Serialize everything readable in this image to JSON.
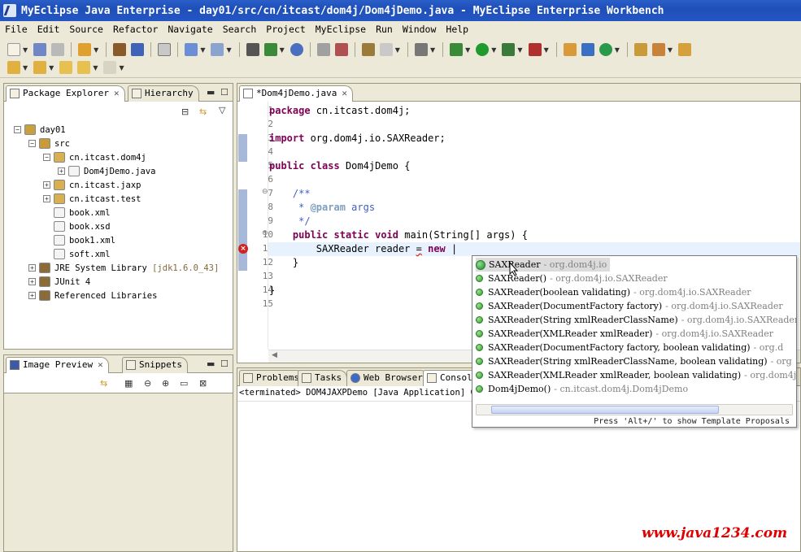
{
  "window": {
    "title": "MyEclipse Java Enterprise - day01/src/cn/itcast/dom4j/Dom4jDemo.java - MyEclipse Enterprise Workbench"
  },
  "menu": [
    "File",
    "Edit",
    "Source",
    "Refactor",
    "Navigate",
    "Search",
    "Project",
    "MyEclipse",
    "Run",
    "Window",
    "Help"
  ],
  "package_explorer": {
    "tabs": [
      "Package Explorer",
      "Hierarchy"
    ],
    "tree": [
      {
        "label": "day01",
        "sub": "",
        "indent": 0,
        "exp": "-",
        "icon": "project-icon"
      },
      {
        "label": "src",
        "sub": "",
        "indent": 1,
        "exp": "-",
        "icon": "source-folder-icon"
      },
      {
        "label": "cn.itcast.dom4j",
        "sub": "",
        "indent": 2,
        "exp": "-",
        "icon": "package-icon"
      },
      {
        "label": "Dom4jDemo.java",
        "sub": "",
        "indent": 3,
        "exp": "+",
        "icon": "java-file-icon"
      },
      {
        "label": "cn.itcast.jaxp",
        "sub": "",
        "indent": 2,
        "exp": "+",
        "icon": "package-icon"
      },
      {
        "label": "cn.itcast.test",
        "sub": "",
        "indent": 2,
        "exp": "+",
        "icon": "package-icon"
      },
      {
        "label": "book.xml",
        "sub": "",
        "indent": 2,
        "exp": "",
        "icon": "xml-file-icon"
      },
      {
        "label": "book.xsd",
        "sub": "",
        "indent": 2,
        "exp": "",
        "icon": "xsd-file-icon"
      },
      {
        "label": "book1.xml",
        "sub": "",
        "indent": 2,
        "exp": "",
        "icon": "xml-file-icon"
      },
      {
        "label": "soft.xml",
        "sub": "",
        "indent": 2,
        "exp": "",
        "icon": "xml-file-icon"
      },
      {
        "label": "JRE System Library ",
        "sub": "[jdk1.6.0_43]",
        "indent": 1,
        "exp": "+",
        "icon": "library-icon"
      },
      {
        "label": "JUnit 4",
        "sub": "",
        "indent": 1,
        "exp": "+",
        "icon": "library-icon"
      },
      {
        "label": "Referenced Libraries",
        "sub": "",
        "indent": 1,
        "exp": "+",
        "icon": "library-icon"
      }
    ]
  },
  "image_preview": {
    "tabs": [
      "Image Preview",
      "Snippets"
    ]
  },
  "editor": {
    "tab": "*Dom4jDemo.java",
    "lines": [
      {
        "n": "1",
        "html": "<span class=\"kw\">package</span> cn.itcast.dom4j;"
      },
      {
        "n": "2",
        "html": ""
      },
      {
        "n": "3",
        "html": "<span class=\"kw\">import</span> org.dom4j.io.SAXReader;"
      },
      {
        "n": "4",
        "html": ""
      },
      {
        "n": "5",
        "html": "<span class=\"kw\">public</span> <span class=\"kw\">class</span> Dom4jDemo {"
      },
      {
        "n": "6",
        "html": ""
      },
      {
        "n": "7",
        "html": "    <span class=\"cm\">/**</span>"
      },
      {
        "n": "8",
        "html": "<span class=\"cm\">     * </span><span class=\"tag\">@param</span><span class=\"cm\"> args</span>"
      },
      {
        "n": "9",
        "html": "<span class=\"cm\">     */</span>"
      },
      {
        "n": "10",
        "html": "    <span class=\"kw\">public</span> <span class=\"kw\">static</span> <span class=\"kw\">void</span> main(String[] args) {"
      },
      {
        "n": "11",
        "html": "        SAXReader reader <span class=\"squiggle\">=</span> <span class=\"kw\">new</span> |"
      },
      {
        "n": "12",
        "html": "    }"
      },
      {
        "n": "13",
        "html": ""
      },
      {
        "n": "14",
        "html": "}"
      },
      {
        "n": "15",
        "html": ""
      }
    ]
  },
  "bottom_views": {
    "tabs": [
      "Problems",
      "Tasks",
      "Web Browser",
      "Consol"
    ],
    "console_text": "<terminated> DOM4JAXPDemo [Java Application] C:\\"
  },
  "completion": {
    "items": [
      {
        "name": "SAXReader",
        "pkg": "- org.dom4j.io",
        "kind": "class"
      },
      {
        "name": "SAXReader()",
        "pkg": "- org.dom4j.io.SAXReader",
        "kind": "ctor"
      },
      {
        "name": "SAXReader(boolean validating)",
        "pkg": "- org.dom4j.io.SAXReader",
        "kind": "ctor"
      },
      {
        "name": "SAXReader(DocumentFactory factory)",
        "pkg": "- org.dom4j.io.SAXReader",
        "kind": "ctor"
      },
      {
        "name": "SAXReader(String xmlReaderClassName)",
        "pkg": "- org.dom4j.io.SAXReader",
        "kind": "ctor"
      },
      {
        "name": "SAXReader(XMLReader xmlReader)",
        "pkg": "- org.dom4j.io.SAXReader",
        "kind": "ctor"
      },
      {
        "name": "SAXReader(DocumentFactory factory, boolean validating)",
        "pkg": "- org.d",
        "kind": "ctor"
      },
      {
        "name": "SAXReader(String xmlReaderClassName, boolean validating)",
        "pkg": "- org",
        "kind": "ctor"
      },
      {
        "name": "SAXReader(XMLReader xmlReader, boolean validating)",
        "pkg": "- org.dom4j",
        "kind": "ctor"
      },
      {
        "name": "Dom4jDemo()",
        "pkg": "- cn.itcast.dom4j.Dom4jDemo",
        "kind": "ctor"
      }
    ],
    "hint": "Press 'Alt+/' to show Template Proposals"
  },
  "watermark": "www.java1234.com",
  "colors": {
    "title_bar": "#2456c4",
    "keyword": "#7f0055",
    "comment": "#3f5fbf",
    "watermark": "#e00000"
  }
}
